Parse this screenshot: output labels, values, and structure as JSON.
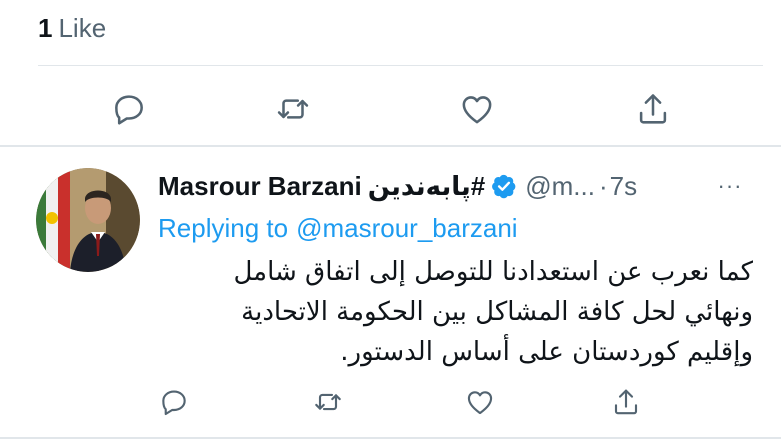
{
  "top_tweet": {
    "likes_count": "1",
    "likes_label": "Like",
    "actions": {
      "reply_icon": "reply-icon",
      "retweet_icon": "retweet-icon",
      "like_icon": "like-icon",
      "share_icon": "share-icon"
    }
  },
  "reply_tweet": {
    "display_name": "Masrour Barzani",
    "hashtag": "#پابەندین",
    "verified_icon": "verified-badge-icon",
    "handle": "@m...",
    "separator": "·",
    "timestamp": "7s",
    "more_label": "···",
    "replying_label": "Replying to",
    "replying_mention": "@masrour_barzani",
    "body_lines": [
      "كما نعرب عن استعدادنا للتوصل إلى اتفاق شامل",
      "ونهائي لحل كافة المشاكل بين الحكومة الاتحادية",
      "وإقليم كوردستان على أساس الدستور."
    ],
    "actions": {
      "reply_icon": "reply-icon",
      "retweet_icon": "retweet-icon",
      "like_icon": "like-icon",
      "share_icon": "share-icon"
    }
  },
  "colors": {
    "accent": "#1d9bf0",
    "text_primary": "#0f1419",
    "text_secondary": "#536471",
    "divider": "#e1e6ea",
    "icon": "#536471"
  }
}
